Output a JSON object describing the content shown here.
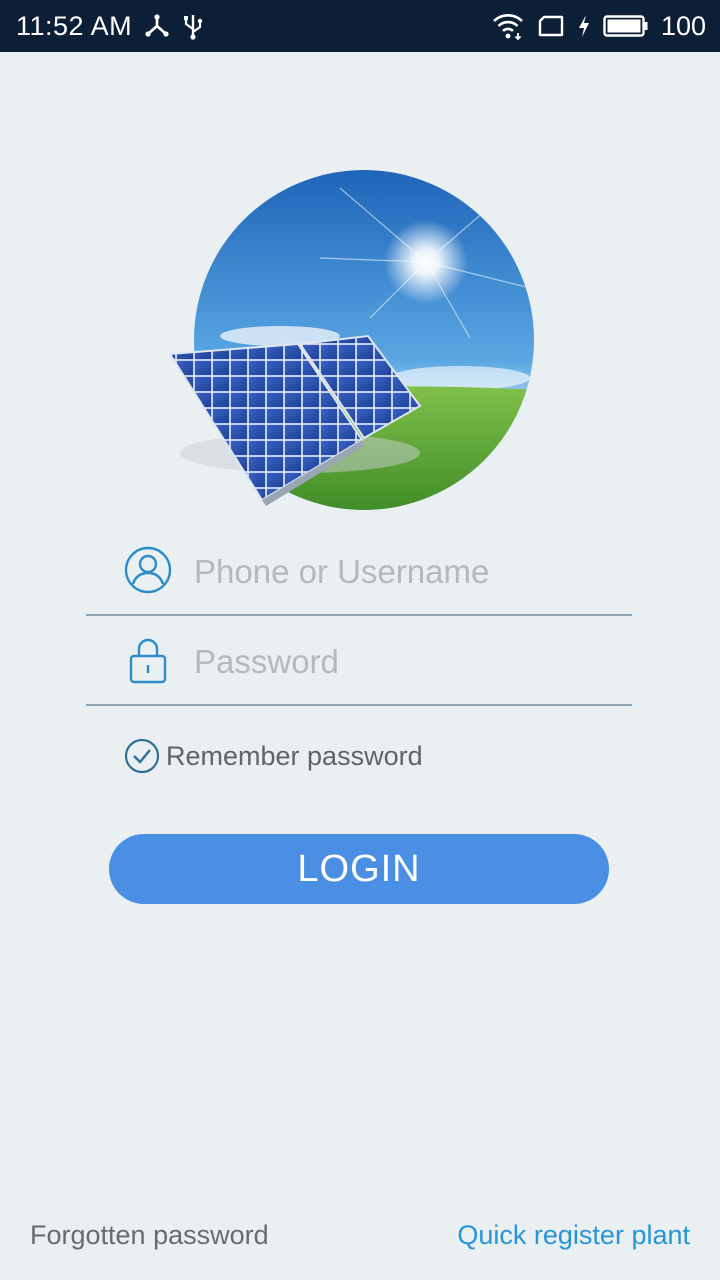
{
  "status_bar": {
    "time": "11:52 AM",
    "battery_level": "100",
    "icons": [
      "network-share-icon",
      "usb-icon",
      "wifi-icon",
      "sim-card-icon",
      "charging-icon",
      "battery-icon"
    ]
  },
  "login": {
    "username_placeholder": "Phone or Username",
    "password_placeholder": "Password",
    "remember_label": "Remember password",
    "remember_checked": true,
    "login_label": "LOGIN"
  },
  "footer": {
    "forgot_label": "Forgotten password",
    "register_label": "Quick register plant"
  },
  "colors": {
    "status_bar_bg": "#0d1f36",
    "background": "#eaeff1",
    "accent": "#4a8fe4",
    "icon_blue": "#2b8dc9",
    "link_blue": "#2796d8"
  }
}
